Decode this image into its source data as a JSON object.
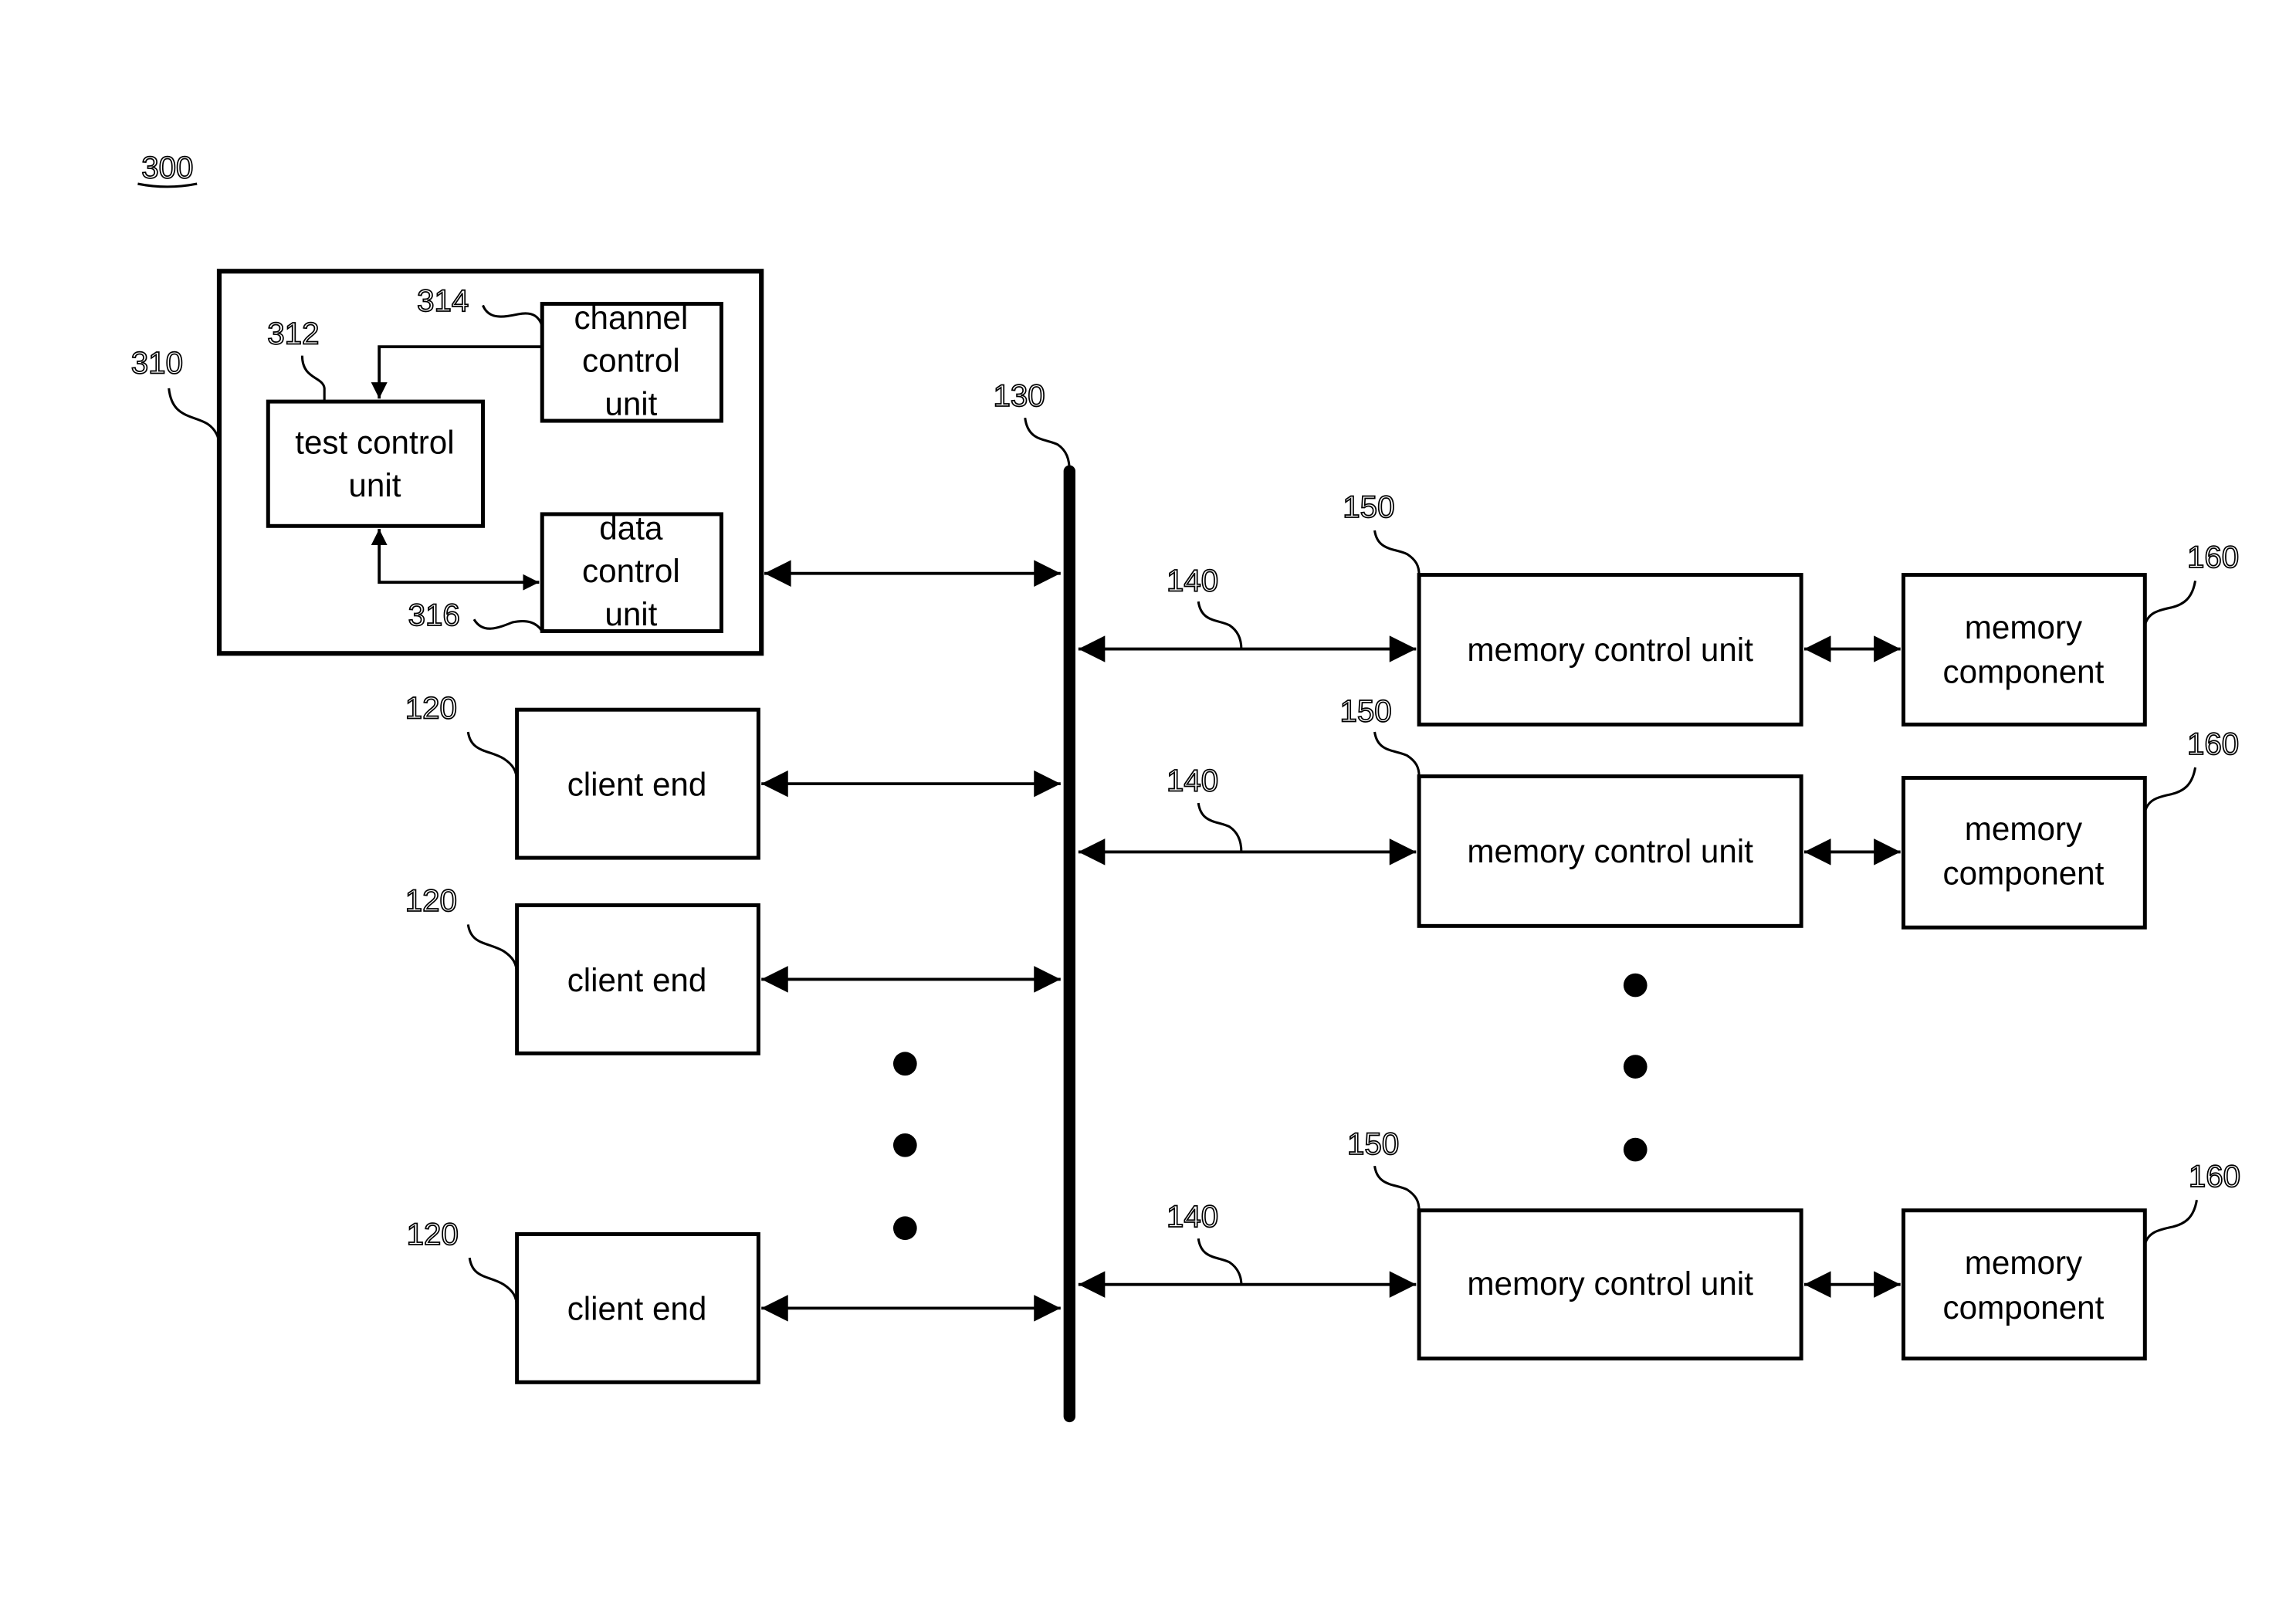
{
  "figure": {
    "number": "300",
    "tester": {
      "ref": "310",
      "test_control_unit": {
        "ref": "312",
        "lines": [
          "test control",
          "unit"
        ]
      },
      "channel_control_unit": {
        "ref": "314",
        "lines": [
          "channel",
          "control",
          "unit"
        ]
      },
      "data_control_unit": {
        "ref": "316",
        "lines": [
          "data",
          "control",
          "unit"
        ]
      }
    },
    "bus": {
      "ref": "130"
    },
    "clients": [
      {
        "ref": "120",
        "label": "client end"
      },
      {
        "ref": "120",
        "label": "client end"
      },
      {
        "ref": "120",
        "label": "client end"
      }
    ],
    "channels": [
      {
        "channel_ref": "140",
        "mcu_ref": "150",
        "mcu_label": "memory control unit",
        "mem_ref": "160",
        "mem_lines": [
          "memory",
          "component"
        ]
      },
      {
        "channel_ref": "140",
        "mcu_ref": "150",
        "mcu_label": "memory control unit",
        "mem_ref": "160",
        "mem_lines": [
          "memory",
          "component"
        ]
      },
      {
        "channel_ref": "140",
        "mcu_ref": "150",
        "mcu_label": "memory control unit",
        "mem_ref": "160",
        "mem_lines": [
          "memory",
          "component"
        ]
      }
    ],
    "ellipsis_marks": [
      "clients-ellipsis",
      "channels-ellipsis"
    ]
  }
}
